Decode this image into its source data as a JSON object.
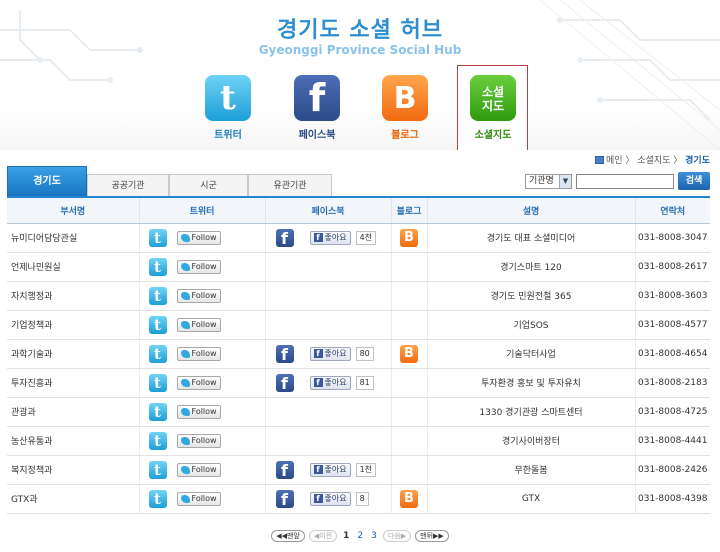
{
  "header": {
    "title": "경기도 소셜 허브",
    "subtitle": "Gyeonggi Province Social Hub"
  },
  "nav": {
    "twitter": {
      "label": "트위터",
      "glyph": "t",
      "color": "#1d9fd8"
    },
    "facebook": {
      "label": "페이스북",
      "glyph": "f",
      "color": "#2c4a88"
    },
    "blog": {
      "label": "블로그",
      "glyph": "B",
      "color": "#f26b10"
    },
    "socialmap": {
      "label": "소셜지도",
      "glyph_line1": "소셜",
      "glyph_line2": "지도",
      "color": "#2f9a10"
    }
  },
  "breadcrumb": {
    "home": "메인",
    "level1": "소셜지도",
    "current": "경기도"
  },
  "tabs": [
    "경기도",
    "공공기관",
    "시군",
    "유관기관"
  ],
  "search": {
    "select_value": "기관명",
    "input_value": "",
    "button_label": "검색"
  },
  "table": {
    "columns": [
      "부서명",
      "트위터",
      "페이스북",
      "블로그",
      "설명",
      "연락처"
    ],
    "follow_label": "Follow",
    "like_label": "좋아요",
    "rows": [
      {
        "dept": "뉴미디어담당관실",
        "twitter": true,
        "facebook": true,
        "likes": "4천",
        "blog": true,
        "desc": "경기도 대표 소셜미디어",
        "phone": "031-8008-3047"
      },
      {
        "dept": "언제나민원실",
        "twitter": true,
        "facebook": false,
        "likes": "",
        "blog": false,
        "desc": "경기스마트 120",
        "phone": "031-8008-2617"
      },
      {
        "dept": "자치행정과",
        "twitter": true,
        "facebook": false,
        "likes": "",
        "blog": false,
        "desc": "경기도 민원전철 365",
        "phone": "031-8008-3603"
      },
      {
        "dept": "기업정책과",
        "twitter": true,
        "facebook": false,
        "likes": "",
        "blog": false,
        "desc": "기업SOS",
        "phone": "031-8008-4577"
      },
      {
        "dept": "과학기술과",
        "twitter": true,
        "facebook": true,
        "likes": "80",
        "blog": true,
        "desc": "기술닥터사업",
        "phone": "031-8008-4654"
      },
      {
        "dept": "투자진흥과",
        "twitter": true,
        "facebook": true,
        "likes": "81",
        "blog": false,
        "desc": "투자환경 홍보 및 투자유치",
        "phone": "031-8008-2183"
      },
      {
        "dept": "관광과",
        "twitter": true,
        "facebook": false,
        "likes": "",
        "blog": false,
        "desc": "1330 경기관광 스마트센터",
        "phone": "031-8008-4725"
      },
      {
        "dept": "농산유통과",
        "twitter": true,
        "facebook": false,
        "likes": "",
        "blog": false,
        "desc": "경기사이버장터",
        "phone": "031-8008-4441"
      },
      {
        "dept": "복지정책과",
        "twitter": true,
        "facebook": true,
        "likes": "1천",
        "blog": false,
        "desc": "무한돌봄",
        "phone": "031-8008-2426"
      },
      {
        "dept": "GTX과",
        "twitter": true,
        "facebook": true,
        "likes": "8",
        "blog": true,
        "desc": "GTX",
        "phone": "031-8008-4398"
      }
    ]
  },
  "pagination": {
    "first": "◀◀맨앞",
    "prev": "◀이전",
    "pages": [
      "1",
      "2",
      "3"
    ],
    "current": "1",
    "next": "다음▶",
    "last": "맨뒤▶▶"
  }
}
